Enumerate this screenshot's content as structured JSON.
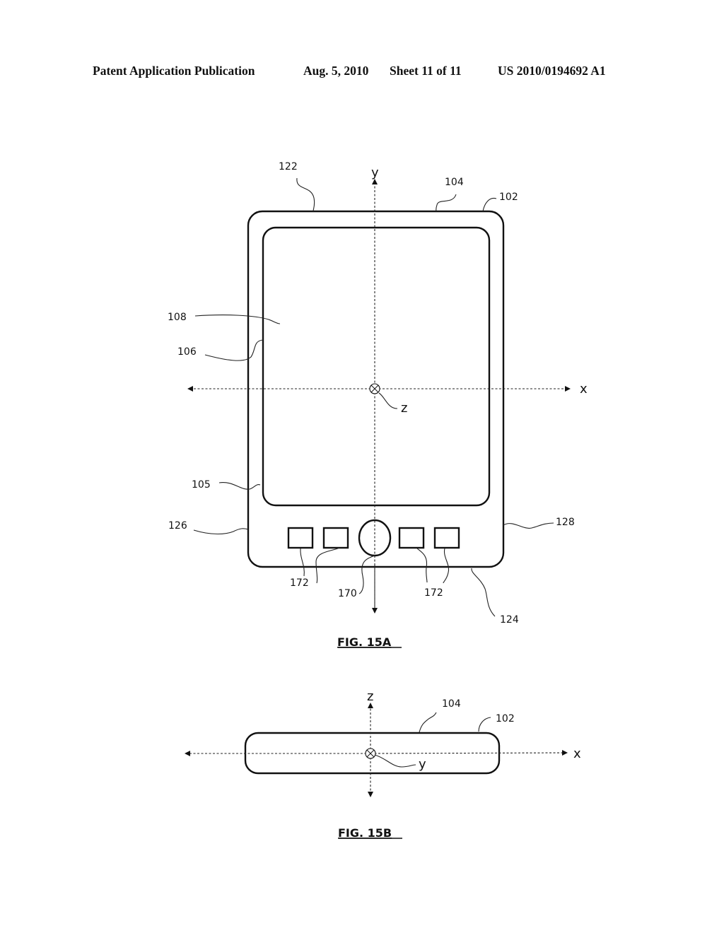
{
  "header": {
    "publication": "Patent Application Publication",
    "date": "Aug. 5, 2010",
    "sheet": "Sheet 11 of 11",
    "number": "US 2010/0194692 A1"
  },
  "figures": [
    {
      "caption": "FIG. 15A",
      "axes": {
        "vertical": "y",
        "horizontal": "x",
        "origin": "z"
      },
      "reference_numerals": {
        "top_edge": "122",
        "front_surface": "104",
        "housing": "102",
        "display": "108",
        "display_edge": "106",
        "bezel": "105",
        "left_edge": "126",
        "right_edge": "128",
        "bottom_edge": "124",
        "center_button": "170",
        "side_buttons_left": "172",
        "side_buttons_right": "172"
      }
    },
    {
      "caption": "FIG. 15B",
      "axes": {
        "vertical": "z",
        "horizontal": "x",
        "origin": "y"
      },
      "reference_numerals": {
        "front_surface": "104",
        "housing": "102"
      }
    }
  ]
}
